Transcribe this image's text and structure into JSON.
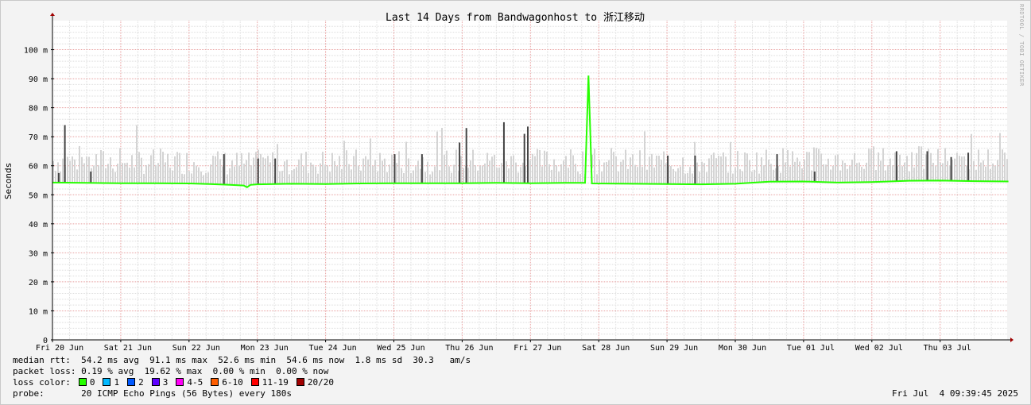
{
  "chart_data": {
    "type": "line",
    "title": "Last 14 Days from Bandwagonhost to 浙江移动",
    "ylabel": "Seconds",
    "ylim": [
      0,
      0.11
    ],
    "y_ticks": [
      {
        "value": 0,
        "label": "0"
      },
      {
        "value": 0.01,
        "label": "10 m"
      },
      {
        "value": 0.02,
        "label": "20 m"
      },
      {
        "value": 0.03,
        "label": "30 m"
      },
      {
        "value": 0.04,
        "label": "40 m"
      },
      {
        "value": 0.05,
        "label": "50 m"
      },
      {
        "value": 0.06,
        "label": "60 m"
      },
      {
        "value": 0.07,
        "label": "70 m"
      },
      {
        "value": 0.08,
        "label": "80 m"
      },
      {
        "value": 0.09,
        "label": "90 m"
      },
      {
        "value": 0.1,
        "label": "100 m"
      }
    ],
    "x_ticks": [
      "Fri 20 Jun",
      "Sat 21 Jun",
      "Sun 22 Jun",
      "Mon 23 Jun",
      "Tue 24 Jun",
      "Wed 25 Jun",
      "Thu 26 Jun",
      "Fri 27 Jun",
      "Sat 28 Jun",
      "Sun 29 Jun",
      "Mon 30 Jun",
      "Tue 01 Jul",
      "Wed 02 Jul",
      "Thu 03 Jul"
    ],
    "x_range_days": [
      0,
      14.5
    ],
    "median_rtt_ms": [
      [
        0.0,
        54.2
      ],
      [
        0.5,
        54.1
      ],
      [
        1.0,
        54.0
      ],
      [
        1.5,
        54.0
      ],
      [
        2.0,
        53.9
      ],
      [
        2.3,
        53.7
      ],
      [
        2.6,
        53.4
      ],
      [
        2.8,
        53.2
      ],
      [
        2.85,
        52.6
      ],
      [
        2.9,
        53.4
      ],
      [
        3.0,
        53.6
      ],
      [
        3.5,
        53.8
      ],
      [
        4.0,
        53.7
      ],
      [
        4.5,
        53.9
      ],
      [
        5.0,
        54.0
      ],
      [
        5.5,
        54.0
      ],
      [
        6.0,
        54.0
      ],
      [
        6.5,
        54.1
      ],
      [
        7.0,
        54.0
      ],
      [
        7.5,
        54.1
      ],
      [
        7.8,
        54.1
      ],
      [
        7.85,
        91.1
      ],
      [
        7.9,
        53.9
      ],
      [
        8.5,
        53.8
      ],
      [
        9.0,
        53.7
      ],
      [
        9.5,
        53.6
      ],
      [
        10.0,
        53.8
      ],
      [
        10.5,
        54.5
      ],
      [
        11.0,
        54.6
      ],
      [
        11.5,
        54.2
      ],
      [
        12.0,
        54.4
      ],
      [
        12.5,
        54.8
      ],
      [
        13.0,
        54.9
      ],
      [
        13.5,
        54.7
      ],
      [
        14.0,
        54.6
      ]
    ],
    "loss_spikes": [
      {
        "x": 0.08,
        "y": 57.5
      },
      {
        "x": 0.17,
        "y": 74.0
      },
      {
        "x": 0.55,
        "y": 58.0
      },
      {
        "x": 2.5,
        "y": 64.0
      },
      {
        "x": 3.0,
        "y": 62.5
      },
      {
        "x": 3.25,
        "y": 62.5
      },
      {
        "x": 5.0,
        "y": 64.0
      },
      {
        "x": 5.4,
        "y": 64.0
      },
      {
        "x": 5.95,
        "y": 68.0
      },
      {
        "x": 6.05,
        "y": 73.0
      },
      {
        "x": 6.6,
        "y": 75.0
      },
      {
        "x": 6.9,
        "y": 71.0
      },
      {
        "x": 6.95,
        "y": 73.5
      },
      {
        "x": 7.85,
        "y": 91.0
      },
      {
        "x": 9.0,
        "y": 63.5
      },
      {
        "x": 9.4,
        "y": 63.5
      },
      {
        "x": 10.6,
        "y": 64.0
      },
      {
        "x": 11.15,
        "y": 58.0
      },
      {
        "x": 12.35,
        "y": 65.0
      },
      {
        "x": 12.8,
        "y": 65.0
      },
      {
        "x": 13.15,
        "y": 63.0
      },
      {
        "x": 13.4,
        "y": 64.5
      }
    ],
    "loss_colors": {
      "0": "#26ff00",
      "1": "#00b8ff",
      "2": "#0059ff",
      "3": "#5e00ff",
      "4-5": "#ff00f6",
      "6-10": "#ff5e00",
      "11-19": "#ff0000",
      "20/20": "#a10000"
    },
    "grid": true
  },
  "stats": {
    "median_rtt": "median rtt:  54.2 ms avg  91.1 ms max  52.6 ms min  54.6 ms now  1.8 ms sd  30.3   am/s",
    "packet_loss": "packet loss: 0.19 % avg  19.62 % max  0.00 % min  0.00 % now",
    "loss_color_label": "loss color:",
    "probe_label": "probe:",
    "probe_value": "20 ICMP Echo Pings (56 Bytes) every 180s",
    "timestamp": "Fri Jul  4 09:39:45 2025"
  },
  "loss_legend": [
    {
      "label": "0",
      "color": "#26ff00"
    },
    {
      "label": "1",
      "color": "#00b8ff"
    },
    {
      "label": "2",
      "color": "#0059ff"
    },
    {
      "label": "3",
      "color": "#5e00ff"
    },
    {
      "label": "4-5",
      "color": "#ff00f6"
    },
    {
      "label": "6-10",
      "color": "#ff5e00"
    },
    {
      "label": "11-19",
      "color": "#ff0000"
    },
    {
      "label": "20/20",
      "color": "#a10000"
    }
  ],
  "watermark": "RRDTOOL / TOBI OETIKER"
}
